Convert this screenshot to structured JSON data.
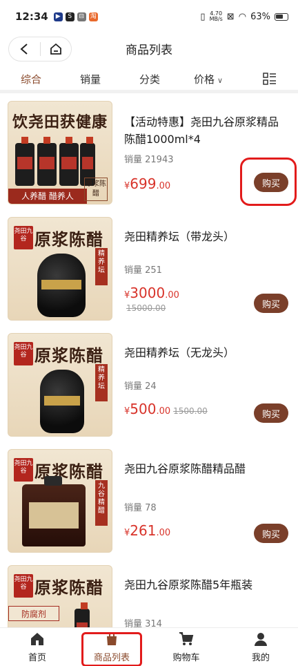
{
  "status_bar": {
    "time": "12:34",
    "net_speed_value": "4.70",
    "net_speed_unit": "MB/s",
    "battery": "63%"
  },
  "title_bar": {
    "title": "商品列表"
  },
  "tabs": [
    "综合",
    "销量",
    "分类",
    "价格"
  ],
  "products": [
    {
      "name": "【活动特惠】尧田九谷原浆精品陈醋1000ml*4",
      "sales": "销量 21943",
      "currency": "¥",
      "price": "699",
      "price_cents": ".00",
      "original_price": "",
      "buy_label": "购买",
      "thumb_headline": "饮尧田获健康",
      "thumb_banner": "人养醋 醋养人",
      "thumb_stamp": "原浆陈醋"
    },
    {
      "name": "尧田精养坛（带龙头）",
      "sales": "销量 251",
      "currency": "¥",
      "price": "3000",
      "price_cents": ".00",
      "original_price": "15000.00",
      "buy_label": "购买",
      "thumb_headline": "原浆陈醋",
      "thumb_seal": "尧田九谷",
      "thumb_side": "精养坛"
    },
    {
      "name": "尧田精养坛（无龙头）",
      "sales": "销量 24",
      "currency": "¥",
      "price": "500",
      "price_cents": ".00",
      "original_price": "1500.00",
      "buy_label": "购买",
      "thumb_headline": "原浆陈醋",
      "thumb_seal": "尧田九谷",
      "thumb_side": "精养坛"
    },
    {
      "name": "尧田九谷原浆陈醋精品醋",
      "sales": "销量 78",
      "currency": "¥",
      "price": "261",
      "price_cents": ".00",
      "original_price": "",
      "buy_label": "购买",
      "thumb_headline": "原浆陈醋",
      "thumb_seal": "尧田九谷",
      "thumb_side": "九谷精醋"
    },
    {
      "name": "尧田九谷原浆陈醋5年瓶装",
      "sales": "销量 314",
      "thumb_headline": "原浆陈醋",
      "thumb_seal": "尧田九谷",
      "thumb_banner": "防腐剂"
    }
  ],
  "bottom_nav": [
    "首页",
    "商品列表",
    "购物车",
    "我的"
  ],
  "colors": {
    "accent": "#8a4a2c",
    "buy_button": "#7a3f2a",
    "price": "#d8332a",
    "highlight": "#e21b1b"
  }
}
